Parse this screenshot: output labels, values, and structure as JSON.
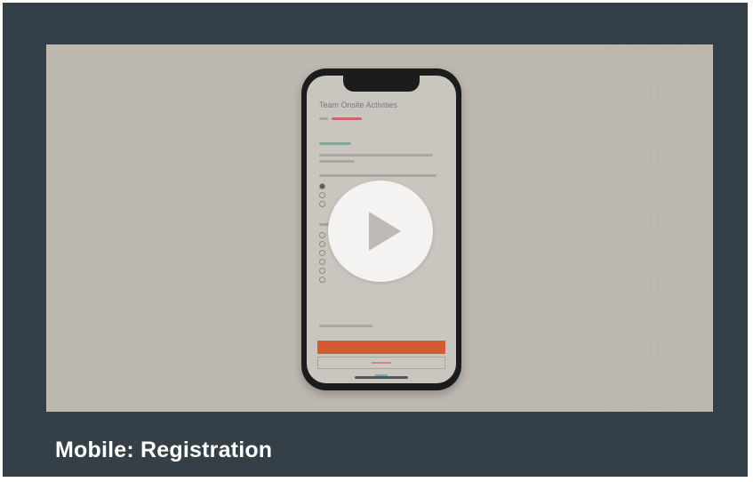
{
  "video": {
    "title": "Mobile: Registration",
    "play_icon": "play-icon"
  },
  "phone_screen": {
    "header": "Team Onsite Activities"
  },
  "colors": {
    "card_background": "#343f47",
    "thumbnail_background": "#bdb8b0",
    "accent_button": "#d35a32",
    "caption_text": "#ffffff"
  }
}
